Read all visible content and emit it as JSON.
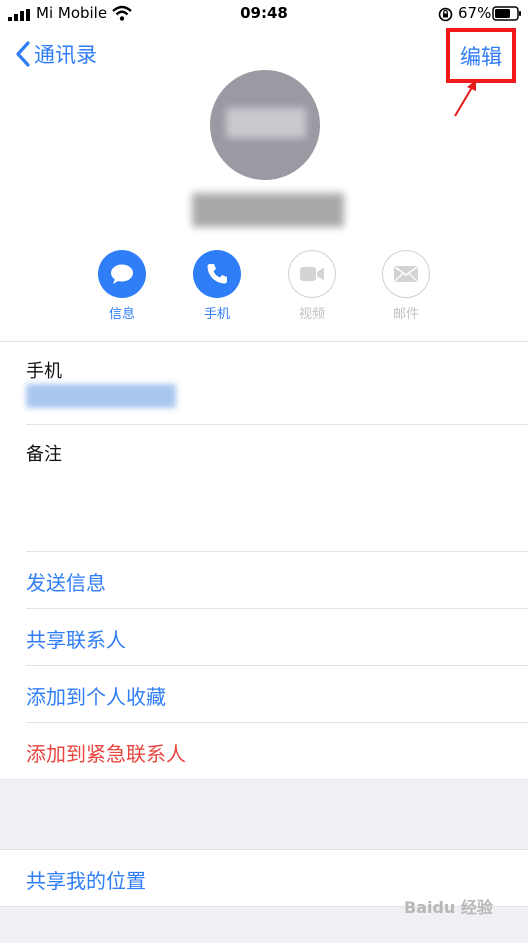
{
  "status_bar": {
    "carrier": "Mi Mobile",
    "time": "09:48",
    "battery": "67%"
  },
  "nav": {
    "back_label": "通讯录",
    "edit_label": "编辑"
  },
  "actions": [
    {
      "label": "信息",
      "icon": "message-icon",
      "enabled": true
    },
    {
      "label": "手机",
      "icon": "phone-icon",
      "enabled": true
    },
    {
      "label": "视频",
      "icon": "video-icon",
      "enabled": false
    },
    {
      "label": "邮件",
      "icon": "mail-icon",
      "enabled": false
    }
  ],
  "fields": {
    "phone_label": "手机",
    "notes_label": "备注"
  },
  "links": {
    "send_message": "发送信息",
    "share_contact": "共享联系人",
    "add_favorites": "添加到个人收藏",
    "add_emergency": "添加到紧急联系人",
    "share_location": "共享我的位置"
  },
  "watermark": "Baidu 经验",
  "colors": {
    "accent": "#2f7df7",
    "danger": "#e9463f",
    "highlight_box": "#f11919",
    "group_background": "#efeff4"
  }
}
